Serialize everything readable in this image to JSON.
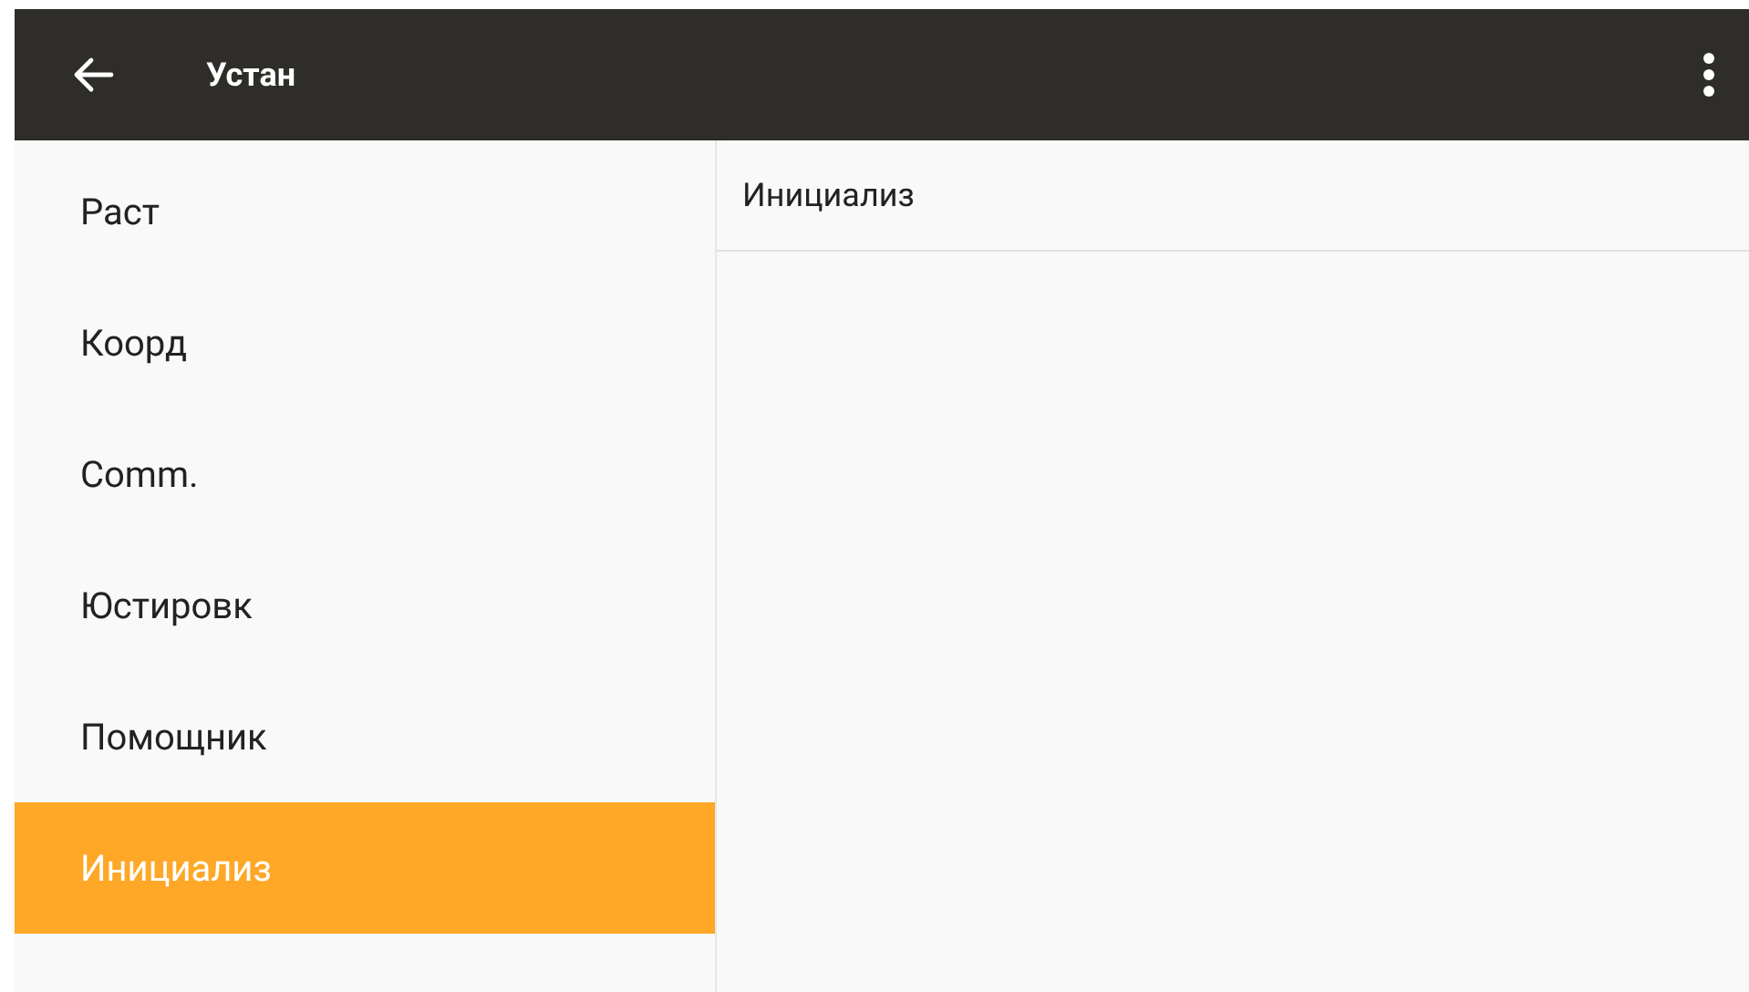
{
  "app_bar": {
    "title": "Устан"
  },
  "sidebar": {
    "items": [
      {
        "label": "Раст",
        "selected": false
      },
      {
        "label": "Коорд",
        "selected": false
      },
      {
        "label": "Comm.",
        "selected": false
      },
      {
        "label": "Юстировк",
        "selected": false
      },
      {
        "label": "Помощник",
        "selected": false
      },
      {
        "label": "Инициализ",
        "selected": true
      }
    ]
  },
  "detail": {
    "title": "Инициализ"
  }
}
